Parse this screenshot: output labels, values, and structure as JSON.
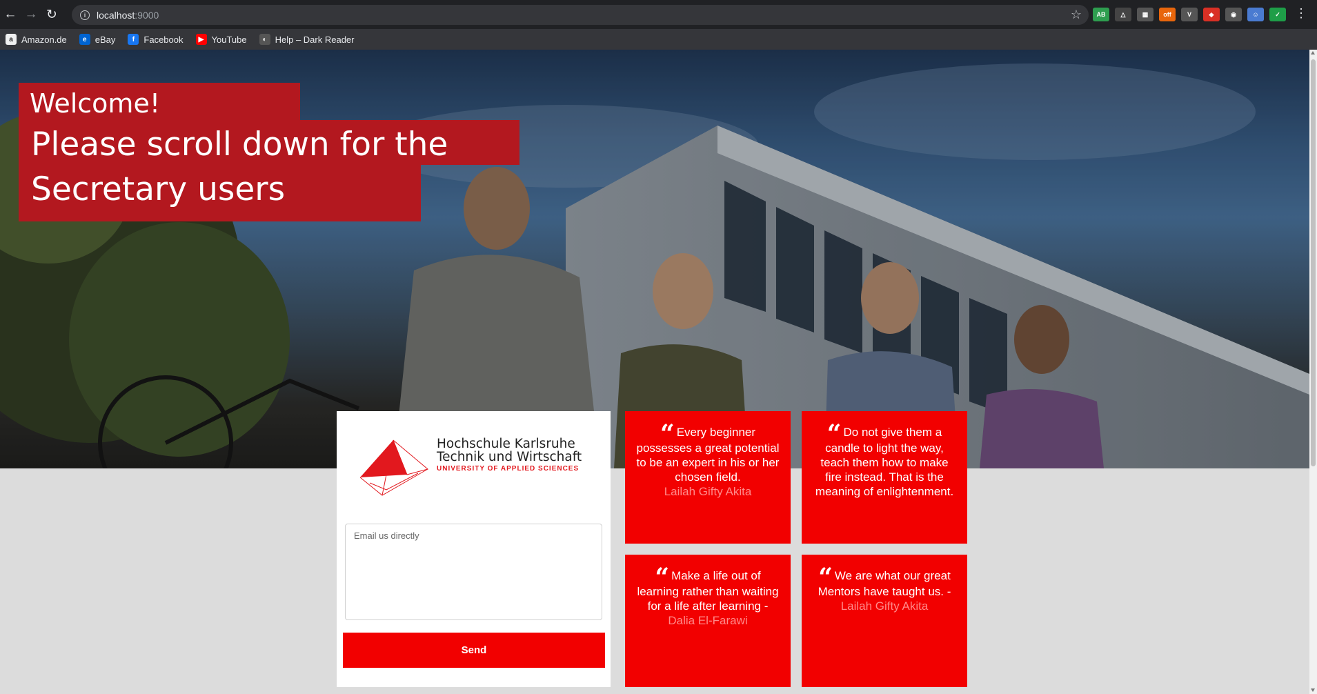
{
  "browser": {
    "url_host": "localhost",
    "url_port": ":9000",
    "extensions": [
      {
        "icon": "adblock-icon",
        "label": "AB",
        "color": "#2e9e4f"
      },
      {
        "icon": "drive-icon",
        "label": "△",
        "color": "#444"
      },
      {
        "icon": "clapper-icon",
        "label": "▦",
        "color": "#555"
      },
      {
        "icon": "off-badge-icon",
        "label": "off",
        "color": "#e8660c"
      },
      {
        "icon": "vue-icon",
        "label": "V",
        "color": "#555"
      },
      {
        "icon": "red-ext-icon",
        "label": "◆",
        "color": "#d93025"
      },
      {
        "icon": "eye-ext-icon",
        "label": "◉",
        "color": "#555"
      },
      {
        "icon": "face-ext-icon",
        "label": "☺",
        "color": "#4a7bd1"
      },
      {
        "icon": "shield-check-icon",
        "label": "✓",
        "color": "#1e9e48"
      }
    ],
    "bookmarks": [
      {
        "label": "Amazon.de",
        "icon": "amazon-icon",
        "glyph": "a",
        "color": "#f0f0f0"
      },
      {
        "label": "eBay",
        "icon": "ebay-icon",
        "glyph": "e",
        "color": "#0064d2"
      },
      {
        "label": "Facebook",
        "icon": "facebook-icon",
        "glyph": "f",
        "color": "#1877f2"
      },
      {
        "label": "YouTube",
        "icon": "youtube-icon",
        "glyph": "▶",
        "color": "#ff0000"
      },
      {
        "label": "Help – Dark Reader",
        "icon": "dark-reader-icon",
        "glyph": "◐",
        "color": "#555"
      }
    ]
  },
  "hero": {
    "welcome": "Welcome!",
    "line1": "Please scroll down for the",
    "line2": "Secretary users"
  },
  "card": {
    "logo_line1": "Hochschule Karlsruhe",
    "logo_line2": "Technik und Wirtschaft",
    "logo_sub": "UNIVERSITY OF APPLIED SCIENCES",
    "email_placeholder": "Email us directly",
    "send_label": "Send"
  },
  "quotes": [
    {
      "text": "Every beginner possesses a great potential to be an expert in his or her chosen field.",
      "author": "Lailah Gifty Akita"
    },
    {
      "text": "Do not give them a candle to light the way, teach them how to make fire instead. That is the meaning of enlightenment.",
      "author": ""
    },
    {
      "text": "Make a life out of learning rather than waiting for a life after learning -",
      "author": "Dalia El-Farawi"
    },
    {
      "text": "We are what our great Mentors have taught us. -",
      "author": "Lailah Gifty Akita"
    }
  ],
  "colors": {
    "accent_red": "#f20000",
    "banner_red": "#b3181f",
    "author_pink": "#ff8a8a"
  }
}
